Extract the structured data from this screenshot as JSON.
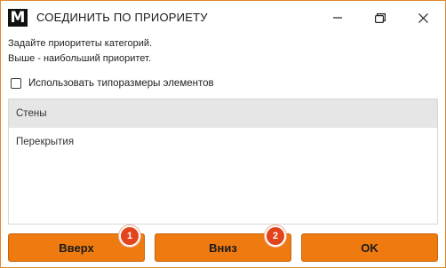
{
  "window": {
    "logo_letter": "M",
    "title": "СОЕДИНИТЬ ПО ПРИОРИЕТУ",
    "accent_color": "#ee7a10",
    "border_color": "#e08a2a"
  },
  "controls": {
    "minimize_icon": "minimize-icon",
    "maximize_icon": "restore-icon",
    "close_icon": "close-icon"
  },
  "hint": {
    "line1": "Задайте приоритеты категорий.",
    "line2": "Выше - наибольший приоритет."
  },
  "option": {
    "use_sizes_label": "Использовать типоразмеры элементов",
    "use_sizes_checked": false
  },
  "list": {
    "items": [
      {
        "label": "Стены",
        "selected": true
      },
      {
        "label": "Перекрытия",
        "selected": false
      }
    ]
  },
  "buttons": {
    "up_label": "Вверх",
    "down_label": "Вниз",
    "ok_label": "OK"
  },
  "badges": {
    "badge1": "1",
    "badge2": "2",
    "color": "#e2441b"
  }
}
